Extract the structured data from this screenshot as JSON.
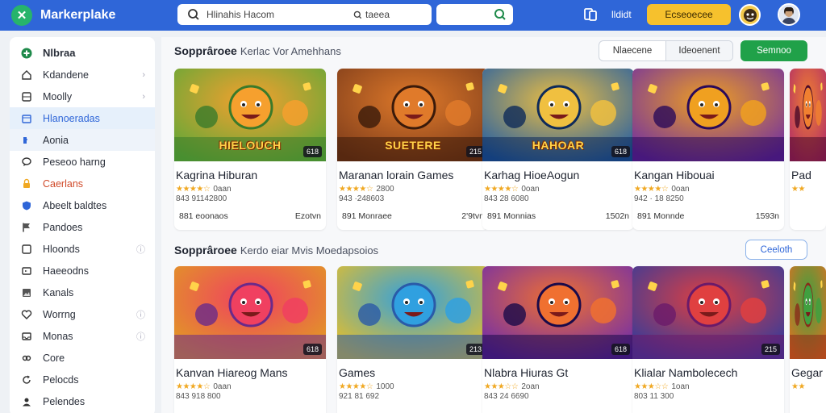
{
  "topbar": {
    "brand": "Markerplake",
    "search_value": "Hlinahis Hacom",
    "search_hint": "taeea",
    "link": "lldidt",
    "cta": "Ecseoecee"
  },
  "sidebar": {
    "items": [
      {
        "label": "Nlbraa",
        "icon": "game-controller-icon",
        "style": "head"
      },
      {
        "label": "Kdandene",
        "icon": "home-icon",
        "chev": "›"
      },
      {
        "label": "Moolly",
        "icon": "grid-icon",
        "chev": "›"
      },
      {
        "label": "Hlanoeradas",
        "icon": "calendar-icon",
        "style": "active"
      },
      {
        "label": "Aonia",
        "icon": "puzzle-icon",
        "style": "selected"
      },
      {
        "label": "Peseoo harng",
        "icon": "chat-icon"
      },
      {
        "label": "Caerlans",
        "icon": "lock-icon",
        "style": "red"
      },
      {
        "label": "Abeelt baldtes",
        "icon": "shield-icon"
      },
      {
        "label": "Pandoes",
        "icon": "flag-icon"
      },
      {
        "label": "Hloonds",
        "icon": "square-icon",
        "chev": "ⓘ"
      },
      {
        "label": "Haeeodns",
        "icon": "tv-icon"
      },
      {
        "label": "Kanals",
        "icon": "image-icon"
      },
      {
        "label": "Worrng",
        "icon": "heart-icon",
        "chev": "ⓘ"
      },
      {
        "label": "Monas",
        "icon": "inbox-icon",
        "chev": "ⓘ"
      },
      {
        "label": "Core",
        "icon": "link-icon"
      },
      {
        "label": "Pelocds",
        "icon": "refresh-icon"
      },
      {
        "label": "Pelendes",
        "icon": "user-icon"
      }
    ]
  },
  "sections": [
    {
      "title": "Sopprâroee",
      "subtitle": "Kerlac Vor Amehhans",
      "cards": [
        {
          "title": "Kagrina Hiburan",
          "rating": "4.5",
          "stars": "★★★★☆",
          "reviews": "0aan",
          "meta": "843 91142800",
          "left": "881 eoonaos",
          "right": "Ezotvn",
          "badge": "618",
          "word": "HIELOUCH"
        },
        {
          "title": "Maranan lorain Games",
          "rating": "3.5",
          "stars": "★★★★☆",
          "reviews": "2800",
          "meta": "943 ·248603",
          "left": "891 Monraee",
          "right": "2'9tvn",
          "badge": "215",
          "word": "SUETERE"
        },
        {
          "title": "Karhag HioeAogun",
          "rating": "4.5",
          "stars": "★★★★☆",
          "reviews": "0oan",
          "meta": "843 28 6080",
          "left": "891 Monnias",
          "right": "1502n",
          "badge": "618",
          "word": "HAHOAR"
        },
        {
          "title": "Kangan Hibouai",
          "rating": "4.5",
          "stars": "★★★★☆",
          "reviews": "0oan",
          "meta": "942 · 18 8250",
          "left": "891 Monnde",
          "right": "1593n",
          "badge": "",
          "word": ""
        },
        {
          "title": "Pad",
          "rating": "",
          "stars": "★★",
          "reviews": "",
          "meta": "",
          "left": "",
          "right": "",
          "badge": "",
          "word": ""
        }
      ]
    },
    {
      "title": "Sopprâroee",
      "subtitle": "Kerdo eiar Mvis Moedapsoios",
      "button": "Ceeloth",
      "cards": [
        {
          "title": "Kanvan Hiareog Mans",
          "rating": "4.5",
          "stars": "★★★★☆",
          "reviews": "0aan",
          "meta": "843 918 800",
          "left": "",
          "right": "",
          "badge": "618",
          "word": ""
        },
        {
          "title": "Games",
          "rating": "4.5",
          "stars": "★★★★☆",
          "reviews": "1000",
          "meta": "921 81 692",
          "left": "",
          "right": "",
          "badge": "213",
          "word": ""
        },
        {
          "title": "Nlabra Hiuras Gt",
          "rating": "4.5",
          "stars": "★★★☆☆",
          "reviews": "2oan",
          "meta": "843 24 6690",
          "left": "",
          "right": "",
          "badge": "618",
          "word": ""
        },
        {
          "title": "Klialar Nambolecech",
          "rating": "4.5",
          "stars": "★★★☆☆",
          "reviews": "1oan",
          "meta": "803 11 300",
          "left": "",
          "right": "",
          "badge": "215",
          "word": ""
        },
        {
          "title": "Gegar",
          "rating": "",
          "stars": "★★",
          "reviews": "",
          "meta": "",
          "left": "",
          "right": "",
          "badge": "",
          "word": ""
        }
      ]
    }
  ],
  "toolbar": {
    "seg_left": "Nlaecene",
    "seg_right": "Ideoenent",
    "green": "Semnoo"
  },
  "colors": {
    "topbar": "#2f66d8",
    "accent_green": "#20a149",
    "cta_yellow": "#f6c12d",
    "star": "#f0a822"
  }
}
